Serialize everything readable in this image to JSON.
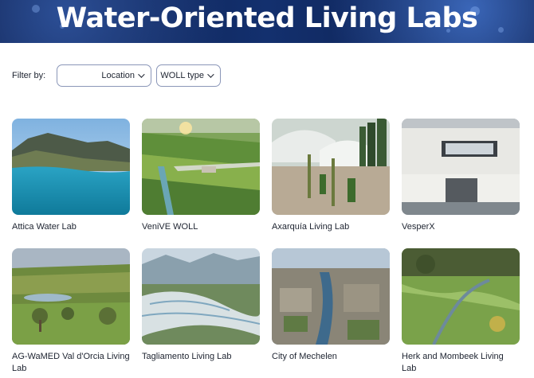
{
  "header": {
    "title": "Water-Oriented Living Labs"
  },
  "filters": {
    "label": "Filter by:",
    "location": "Location",
    "woll_type": "WOLL type"
  },
  "labs": [
    {
      "name": "Attica Water Lab"
    },
    {
      "name": "VeniVE WOLL"
    },
    {
      "name": "Axarquía Living Lab"
    },
    {
      "name": "VesperX"
    },
    {
      "name": "AG-WaMED Val d'Orcia Living Lab"
    },
    {
      "name": "Tagliamento Living Lab"
    },
    {
      "name": "City of Mechelen"
    },
    {
      "name": "Herk and Mombeek Living Lab"
    }
  ]
}
